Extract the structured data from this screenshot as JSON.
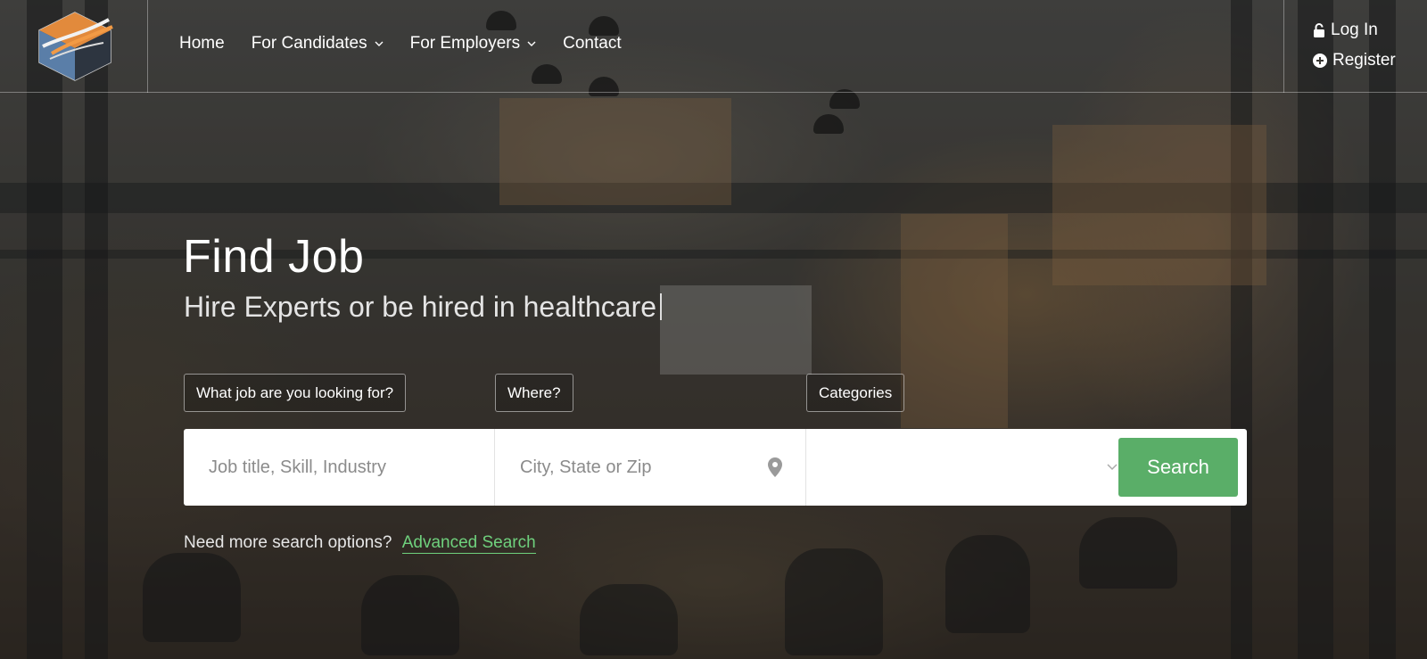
{
  "nav": {
    "items": [
      {
        "label": "Home",
        "has_dropdown": false
      },
      {
        "label": "For Candidates",
        "has_dropdown": true
      },
      {
        "label": "For Employers",
        "has_dropdown": true
      },
      {
        "label": "Contact",
        "has_dropdown": false
      }
    ]
  },
  "auth": {
    "login_label": "Log In",
    "register_label": "Register"
  },
  "hero": {
    "title": "Find Job",
    "subtitle": "Hire Experts or be hired in healthcare"
  },
  "search": {
    "job_tag": "What job are you looking for?",
    "where_tag": "Where?",
    "categories_tag": "Categories",
    "job_placeholder": "Job title, Skill, Industry",
    "location_placeholder": "City, State or Zip",
    "category_value": "",
    "button_label": "Search"
  },
  "footer_hint": {
    "text": "Need more search options?",
    "link_label": "Advanced Search"
  },
  "colors": {
    "accent_green": "#5aae68",
    "link_green": "#6fd17d"
  },
  "icons": [
    "logo-icon",
    "chevron-down-icon",
    "lock-icon",
    "plus-circle-icon",
    "map-pin-icon"
  ]
}
